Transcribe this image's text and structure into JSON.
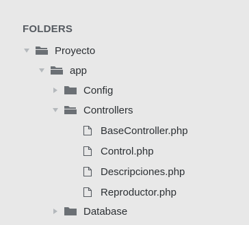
{
  "sidebar": {
    "header": "FOLDERS",
    "items": [
      {
        "label": "Proyecto",
        "type": "folder",
        "expanded": true
      },
      {
        "label": "app",
        "type": "folder",
        "expanded": true
      },
      {
        "label": "Config",
        "type": "folder",
        "expanded": false
      },
      {
        "label": "Controllers",
        "type": "folder",
        "expanded": true
      },
      {
        "label": "BaseController.php",
        "type": "file"
      },
      {
        "label": "Control.php",
        "type": "file"
      },
      {
        "label": "Descripciones.php",
        "type": "file"
      },
      {
        "label": "Reproductor.php",
        "type": "file"
      },
      {
        "label": "Database",
        "type": "folder",
        "expanded": false
      }
    ]
  },
  "colors": {
    "background": "#e8e8e8",
    "header_text": "#555a60",
    "item_text": "#2b2f33",
    "arrow": "#b4b8bc",
    "folder": "#6b7075"
  }
}
